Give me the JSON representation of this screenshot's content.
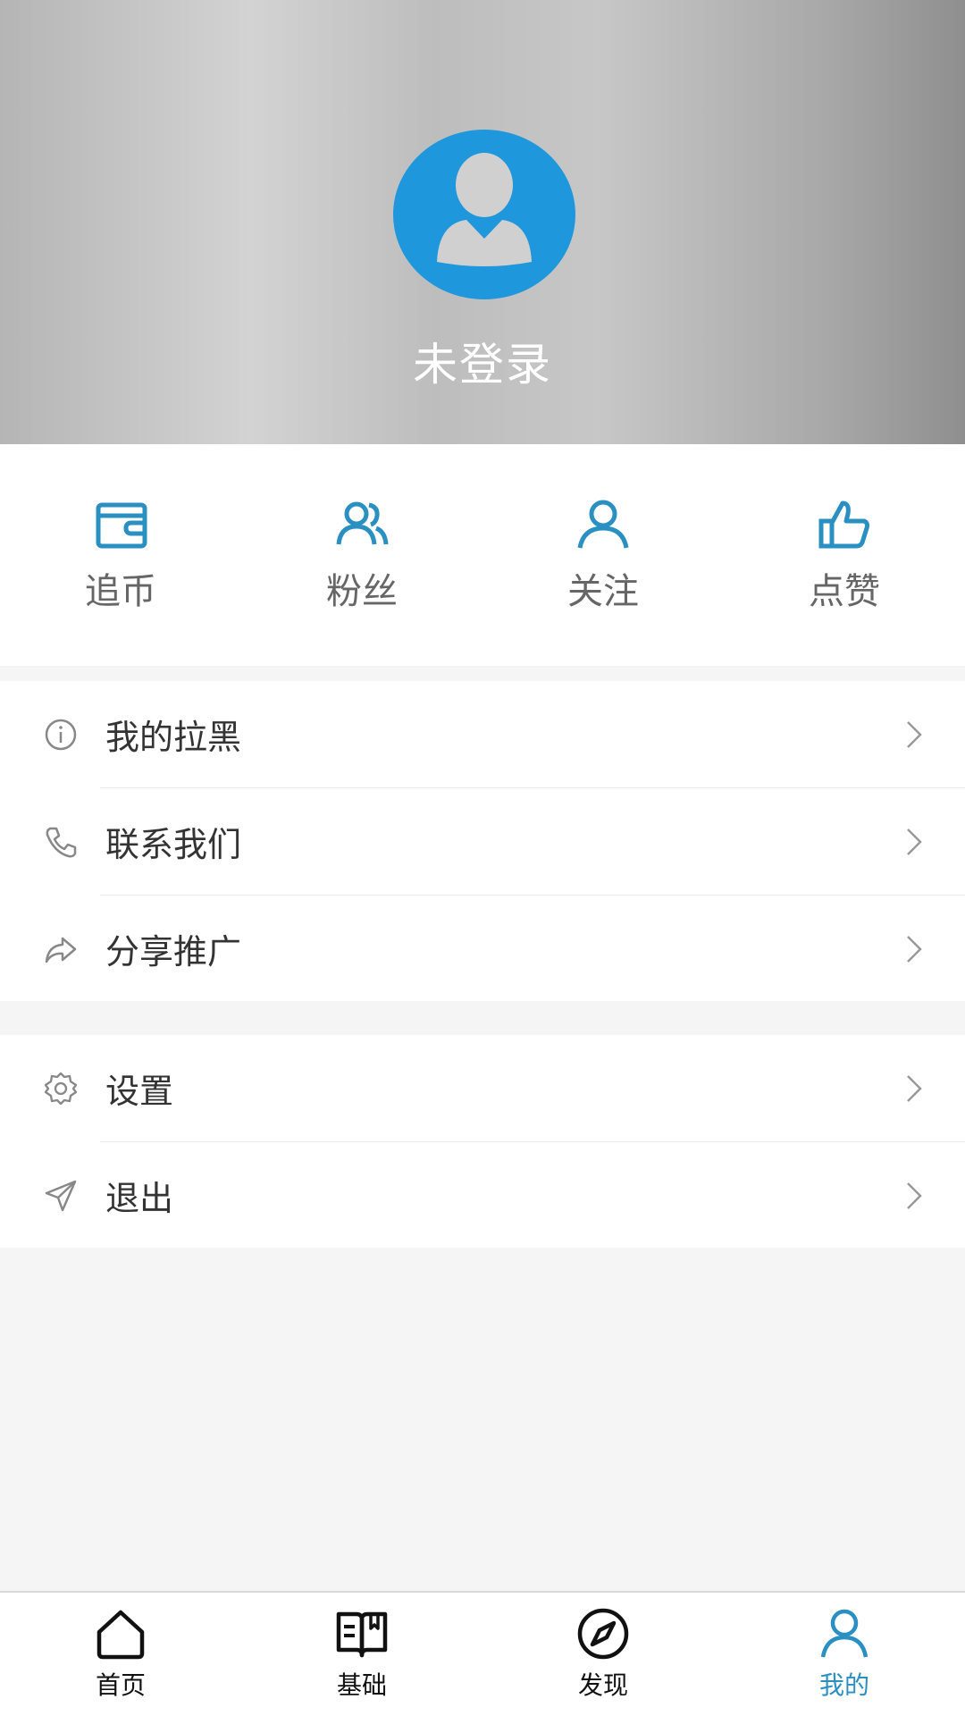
{
  "header": {
    "username": "未登录",
    "avatar_icon": "avatar-icon",
    "colors": {
      "avatar_bg": "#1e97dc"
    }
  },
  "stats": [
    {
      "label": "追币",
      "icon": "wallet-icon"
    },
    {
      "label": "粉丝",
      "icon": "fans-icon"
    },
    {
      "label": "关注",
      "icon": "person-icon"
    },
    {
      "label": "点赞",
      "icon": "thumbs-up-icon"
    }
  ],
  "menu_group_1": [
    {
      "label": "我的拉黑",
      "icon": "info-icon"
    },
    {
      "label": "联系我们",
      "icon": "phone-icon"
    },
    {
      "label": "分享推广",
      "icon": "share-icon"
    }
  ],
  "menu_group_2": [
    {
      "label": "设置",
      "icon": "gear-icon"
    },
    {
      "label": "退出",
      "icon": "send-icon"
    }
  ],
  "nav": {
    "tabs": [
      {
        "label": "首页",
        "icon": "home-icon"
      },
      {
        "label": "基础",
        "icon": "book-icon"
      },
      {
        "label": "发现",
        "icon": "compass-icon"
      },
      {
        "label": "我的",
        "icon": "user-icon"
      }
    ],
    "active": "我的",
    "colors": {
      "active": "#2a8fc1",
      "inactive": "#111111"
    }
  }
}
